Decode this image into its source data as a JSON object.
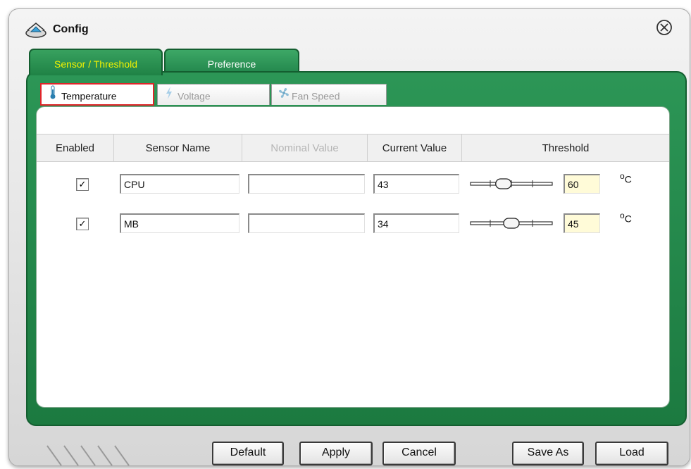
{
  "window": {
    "title": "Config"
  },
  "outer_tabs": [
    {
      "label": "Sensor / Threshold",
      "active": true
    },
    {
      "label": "Preference",
      "active": false
    }
  ],
  "sub_tabs": [
    {
      "label": "Temperature",
      "icon": "thermometer-icon",
      "active": true
    },
    {
      "label": "Voltage",
      "icon": "lightning-icon",
      "active": false
    },
    {
      "label": "Fan Speed",
      "icon": "fan-icon",
      "active": false
    }
  ],
  "columns": [
    "Enabled",
    "Sensor Name",
    "Nominal Value",
    "Current Value",
    "Threshold"
  ],
  "rows": [
    {
      "enabled": true,
      "check": "✓",
      "sensor_name": "CPU",
      "nominal_value": "",
      "current_value": "43",
      "threshold": "60",
      "unit": "C",
      "slider_level": 0.38
    },
    {
      "enabled": true,
      "check": "✓",
      "sensor_name": "MB",
      "nominal_value": "",
      "current_value": "34",
      "threshold": "45",
      "unit": "C",
      "slider_level": 0.5
    }
  ],
  "buttons": {
    "default": "Default",
    "apply": "Apply",
    "cancel": "Cancel",
    "save_as": "Save As",
    "load": "Load"
  },
  "colors": {
    "accent_green": "#1f8245",
    "active_tab_text": "#f2f200",
    "highlight_border": "#e0252a",
    "threshold_bg": "#fffbd8"
  }
}
